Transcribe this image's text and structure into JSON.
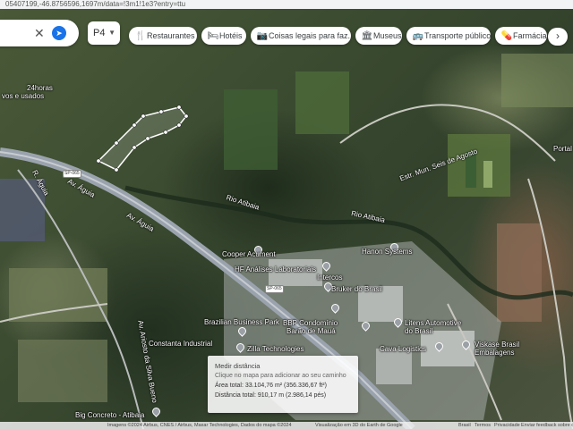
{
  "browser": {
    "url": "05407199,-46.8756596,1697m/data=!3m1!1e3?entry=ttu"
  },
  "search": {
    "close_icon": "close-icon",
    "directions_icon": "directions-icon"
  },
  "language": {
    "label": "P4"
  },
  "chips": [
    {
      "icon": "restaurant-icon",
      "label": "Restaurantes"
    },
    {
      "icon": "hotel-icon",
      "label": "Hotéis"
    },
    {
      "icon": "camera-icon",
      "label": "Coisas legais para faz..."
    },
    {
      "icon": "museum-icon",
      "label": "Museus"
    },
    {
      "icon": "transit-icon",
      "label": "Transporte público"
    },
    {
      "icon": "pharmacy-icon",
      "label": "Farmácias"
    }
  ],
  "map": {
    "labels": {
      "top_left_1": "24horas",
      "top_left_2": "vos e usados",
      "portal": "Portal",
      "rio_atibaia_1": "Rio Atibaia",
      "rio_atibaia_2": "Rio Atibaia",
      "hanon": "Hanon Systems",
      "cooper": "Cooper Acument",
      "hf": "HF Análises Laboratoriais",
      "intercos": "Intercos",
      "bruker": "Bruker do Brasil",
      "bbp_1": "BBP Condomínio",
      "bbp_2": "Barão de Mauá",
      "bbp_park": "Brazilian Business Park",
      "litens_1": "Litens Automotive",
      "litens_2": "do Brasil",
      "viskase_1": "Viskase Brasil",
      "viskase_2": "Embalagens",
      "cava": "Cava Logistics",
      "zilla": "Zilla Technologies",
      "constanta": "Constanta Industrial",
      "big_concreto": "Big Concreto - Atibaia",
      "av_aguia_1": "Av. Águia",
      "av_aguia_2": "Av. Águia",
      "estr_mun": "Estr. Mun. Seis de Agosto",
      "sp_road_1": "SP-065",
      "sp_road_2": "SP-065",
      "r_left": "R. Águia",
      "av_vertical": "Av. Ariosto da Silva Bueno"
    }
  },
  "measure": {
    "title": "Medir distância",
    "hint": "Clique no mapa para adicionar ao seu caminho",
    "area": "Área total: 33.104,76 m² (356.336,67 ft²)",
    "distance": "Distância total: 910,17 m (2.986,14 pés)"
  },
  "footer": {
    "imagery": "Imagens ©2024 Airbus, CNES / Airbus, Maxar Technologies, Dados do mapa ©2024",
    "mode": "Visualização em 3D do Earth de Google",
    "brazil": "Brasil",
    "terms": "Termos",
    "privacy": "Privacidade",
    "feedback": "Enviar feedback sobre o produto",
    "scale": "200 m"
  },
  "colors": {
    "accent": "#1a73e8",
    "road": "#9aa3ad",
    "measure_line": "#ffffff"
  }
}
